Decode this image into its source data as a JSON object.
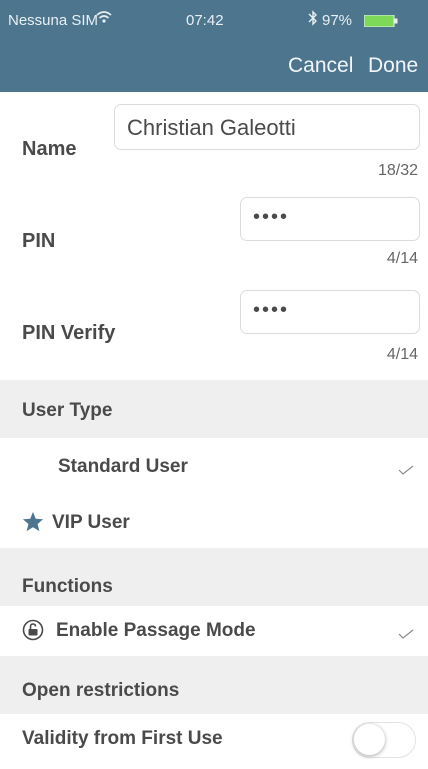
{
  "status": {
    "carrier": "Nessuna SIM",
    "time": "07:42",
    "battery": "97%"
  },
  "nav": {
    "cancel": "Cancel",
    "done": "Done"
  },
  "form": {
    "name_label": "Name",
    "name_value": "Christian Galeotti",
    "name_count": "18/32",
    "pin_label": "PIN",
    "pin_masked": "••••",
    "pin_count": "4/14",
    "pin_verify_label": "PIN Verify",
    "pin_verify_masked": "••••",
    "pin_verify_count": "4/14"
  },
  "user_type": {
    "header": "User Type",
    "options": [
      {
        "label": "Standard User",
        "selected": true
      },
      {
        "label": "VIP User",
        "selected": false
      }
    ]
  },
  "functions": {
    "header": "Functions",
    "items": [
      {
        "label": "Enable Passage Mode",
        "checked": true
      }
    ]
  },
  "restrictions": {
    "header": "Open restrictions",
    "items": [
      {
        "label": "Validity from First Use",
        "on": false
      }
    ]
  },
  "colors": {
    "bar": "#4d758e",
    "section": "#efefef",
    "text": "#4a4a4a"
  }
}
